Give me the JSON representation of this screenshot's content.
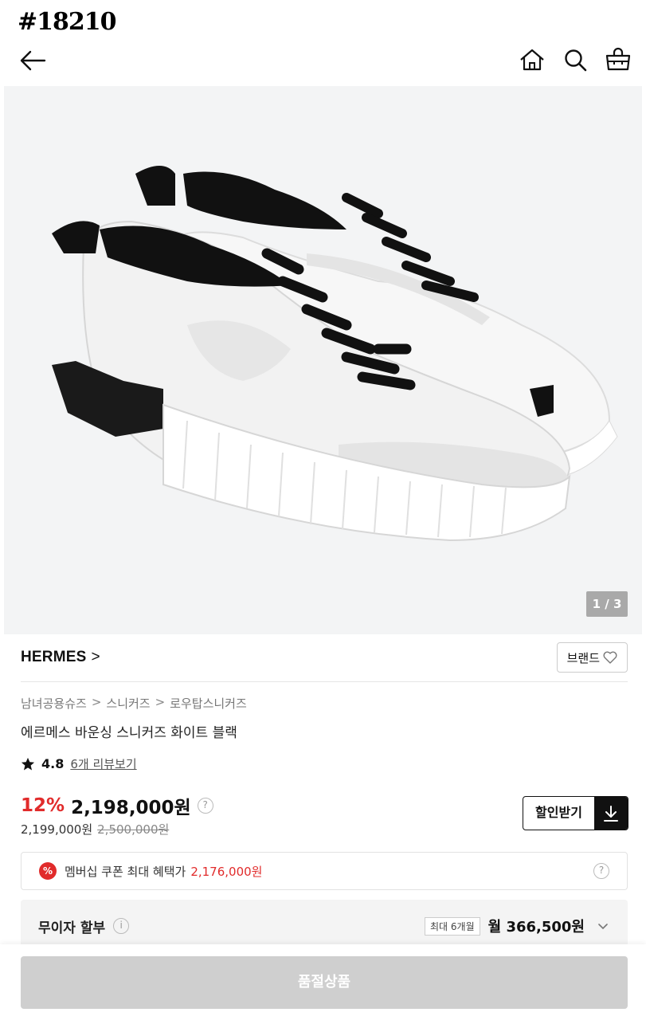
{
  "post_id": "#18210",
  "topbar": {
    "icons": [
      "back-arrow-icon",
      "home-icon",
      "search-icon",
      "cart-icon"
    ]
  },
  "hero": {
    "pager": "1 / 3",
    "bg_color": "#f3f4f5"
  },
  "brand": {
    "name": "HERMES",
    "chevron": ">",
    "follow_label": "브랜드",
    "follow_icon": "heart-icon"
  },
  "breadcrumb": [
    "남녀공용슈즈",
    "스니커즈",
    "로우탑스니커즈"
  ],
  "breadcrumb_sep": ">",
  "product": {
    "title": "에르메스 바운싱 스니커즈 화이트 블랙",
    "rating": "4.8",
    "reviews_label": "6개 리뷰보기"
  },
  "price": {
    "discount": "12%",
    "sale": "2,198,000원",
    "secondary": "2,199,000원",
    "original": "2,500,000원",
    "coupon_label": "할인받기"
  },
  "membership": {
    "badge": "%",
    "text": "멤버십 쿠폰 최대 혜택가",
    "amount": "2,176,000원"
  },
  "installment": {
    "label": "무이자 할부",
    "max": "최대 6개월",
    "monthly": "월 366,500원"
  },
  "cta": {
    "label": "품절상품"
  },
  "colors": {
    "accent_red": "#e12b2b",
    "disabled_gray": "#cfcfcf"
  }
}
